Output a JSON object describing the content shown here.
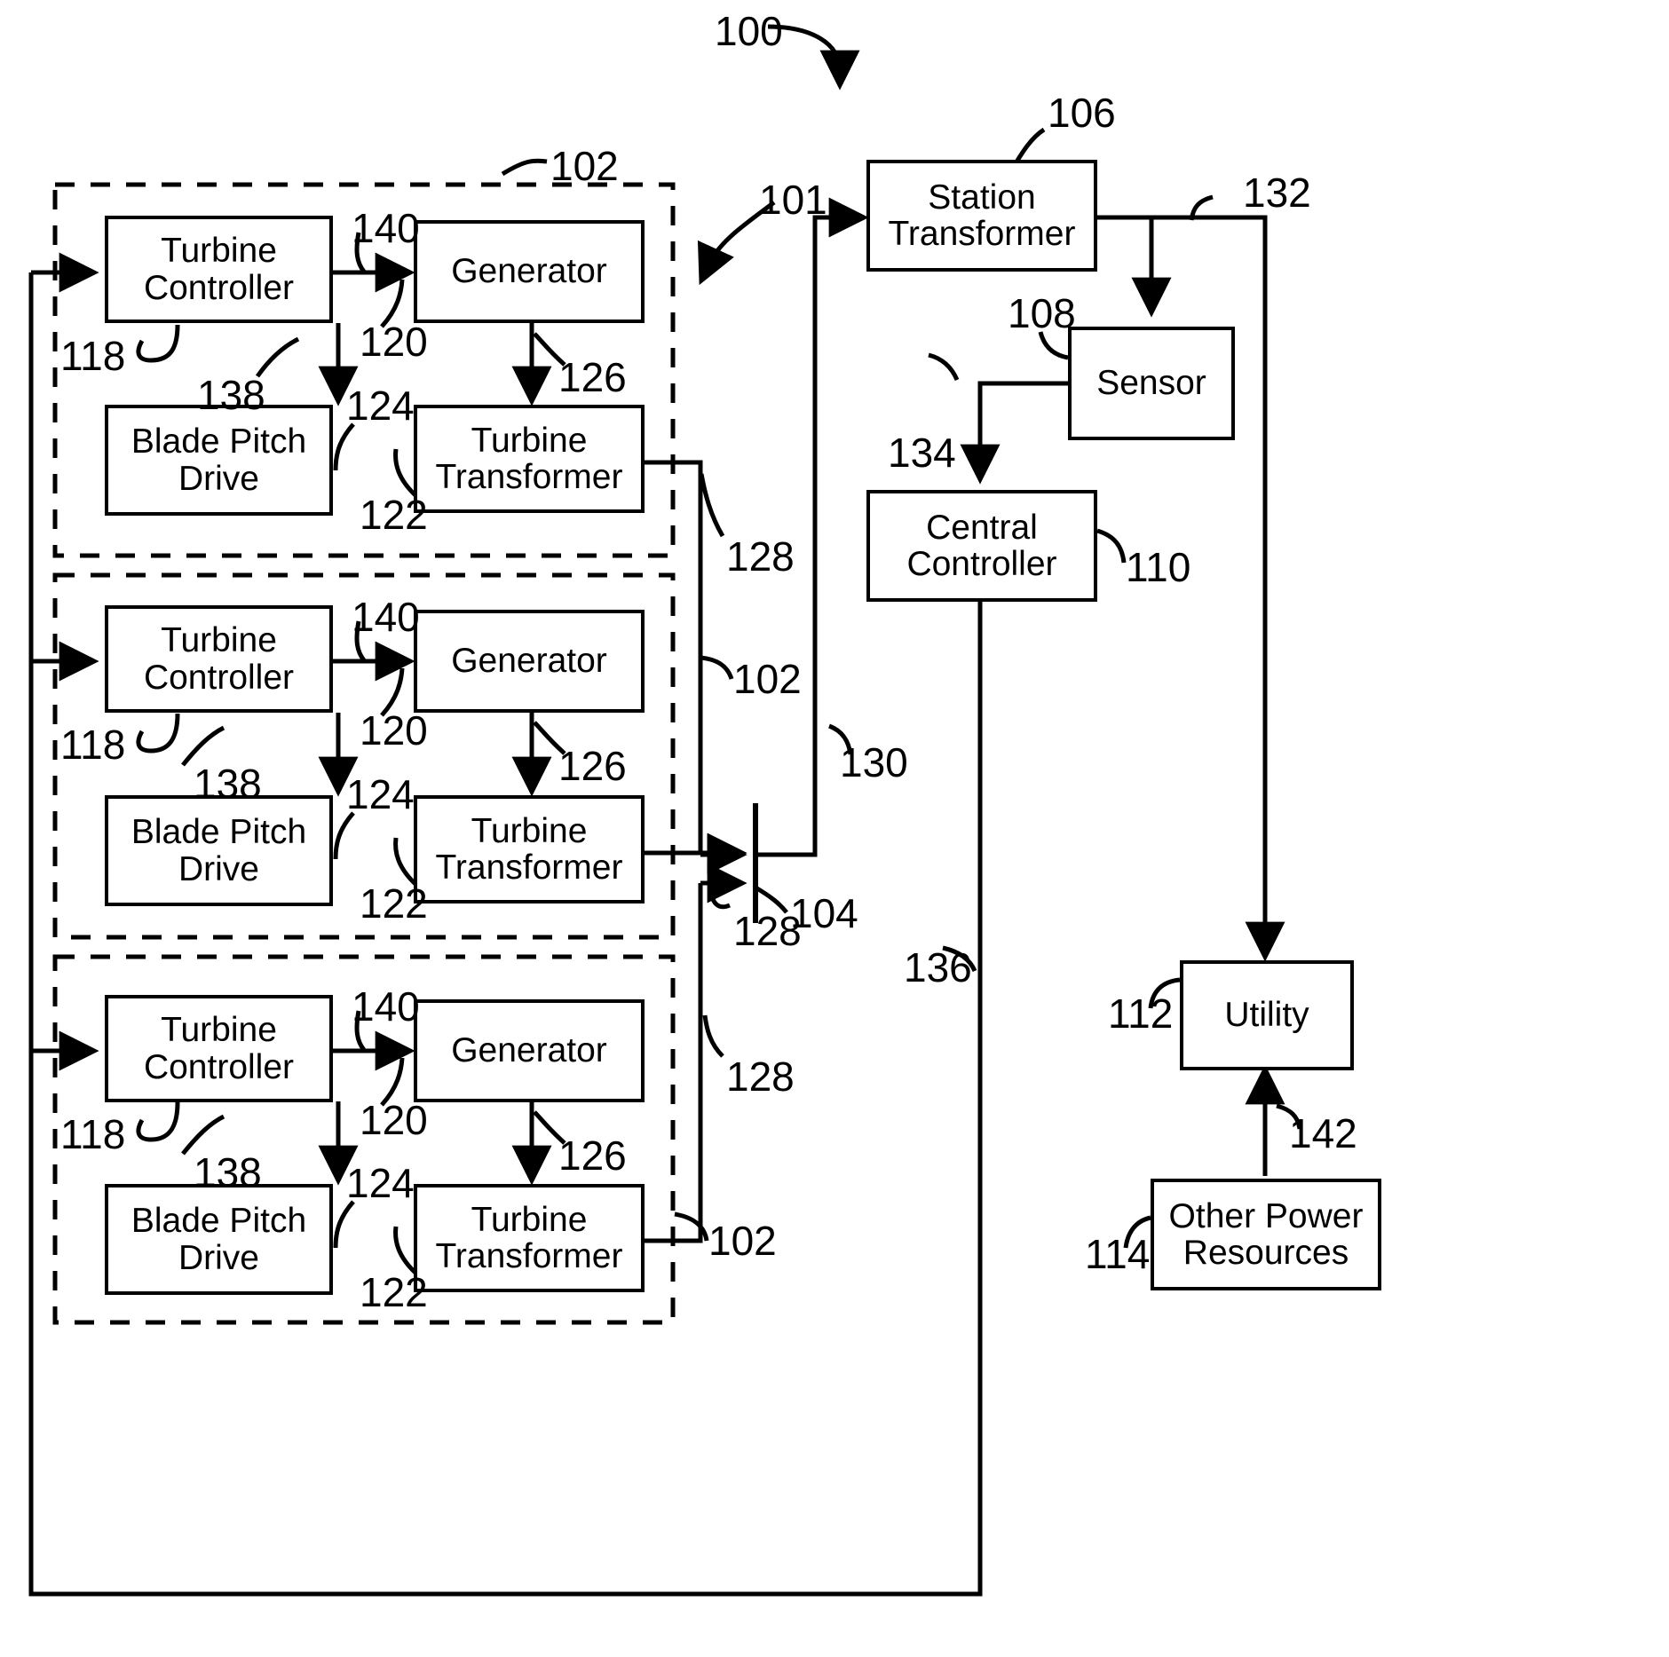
{
  "figure": {
    "type": "patent-block-diagram",
    "title_ref": "100",
    "description": "Wind farm power generation system block diagram"
  },
  "blocks": {
    "turbine_controller": "Turbine Controller",
    "generator": "Generator",
    "blade_pitch_drive": "Blade Pitch Drive",
    "turbine_transformer": "Turbine Transformer",
    "station_transformer": "Station Transformer",
    "sensor": "Sensor",
    "central_controller": "Central Controller",
    "utility": "Utility",
    "other_power_resources": "Other Power Resources"
  },
  "groups": [
    {
      "id": "turbine-group-1",
      "ref": "102",
      "blocks": [
        "Turbine Controller",
        "Generator",
        "Blade Pitch Drive",
        "Turbine Transformer"
      ],
      "refs": {
        "controller": "118",
        "controller_to_generator": "140",
        "generator": "120",
        "generator_to_transformer": "126",
        "blade_pitch_link": "138",
        "blade_pitch_drive": "124",
        "transformer": "122",
        "output": "128"
      }
    },
    {
      "id": "turbine-group-2",
      "ref": "102",
      "blocks": [
        "Turbine Controller",
        "Generator",
        "Blade Pitch Drive",
        "Turbine Transformer"
      ],
      "refs": {
        "controller": "118",
        "controller_to_generator": "140",
        "generator": "120",
        "generator_to_transformer": "126",
        "blade_pitch_link": "138",
        "blade_pitch_drive": "124",
        "transformer": "122",
        "output": "128"
      }
    },
    {
      "id": "turbine-group-3",
      "ref": "102",
      "blocks": [
        "Turbine Controller",
        "Generator",
        "Blade Pitch Drive",
        "Turbine Transformer"
      ],
      "refs": {
        "controller": "118",
        "controller_to_generator": "140",
        "generator": "120",
        "generator_to_transformer": "126",
        "blade_pitch_link": "138",
        "blade_pitch_drive": "124",
        "transformer": "122",
        "output": "128"
      }
    }
  ],
  "reference_numerals": {
    "system": "100",
    "farm_region": "101",
    "turbine_unit": "102",
    "collector_bus": "104",
    "station_transformer": "106",
    "sensor": "108",
    "central_controller": "110",
    "utility": "112",
    "other_power_resources": "114",
    "turbine_controller": "118",
    "generator": "120",
    "turbine_transformer": "122",
    "blade_pitch_drive": "124",
    "generator_output": "126",
    "turbine_transformer_output": "128",
    "bus_to_station_transformer": "130",
    "station_transformer_output": "132",
    "sensor_to_central_controller": "134",
    "central_controller_to_turbines": "136",
    "controller_to_blade_pitch": "138",
    "controller_to_generator": "140",
    "other_power_to_utility": "142"
  },
  "labels": {
    "l100": "100",
    "l101": "101",
    "l102_a": "102",
    "l102_b": "102",
    "l102_c": "102",
    "l104": "104",
    "l106": "106",
    "l108": "108",
    "l110": "110",
    "l112": "112",
    "l114": "114",
    "l118_a": "118",
    "l118_b": "118",
    "l118_c": "118",
    "l120_a": "120",
    "l120_b": "120",
    "l120_c": "120",
    "l122_a": "122",
    "l122_b": "122",
    "l122_c": "122",
    "l124_a": "124",
    "l124_b": "124",
    "l124_c": "124",
    "l126_a": "126",
    "l126_b": "126",
    "l126_c": "126",
    "l128_a": "128",
    "l128_b": "128",
    "l128_c": "128",
    "l130": "130",
    "l132": "132",
    "l134": "134",
    "l136": "136",
    "l138_a": "138",
    "l138_b": "138",
    "l138_c": "138",
    "l140_a": "140",
    "l140_b": "140",
    "l140_c": "140",
    "l142": "142"
  },
  "colors": {
    "line": "#000000",
    "background": "#ffffff"
  }
}
